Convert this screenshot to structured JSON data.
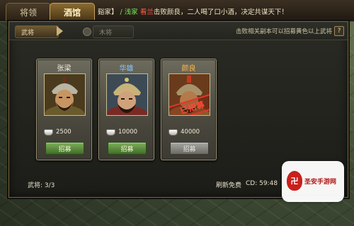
{
  "tabs": [
    {
      "label": "将领"
    },
    {
      "label": "酒馆"
    }
  ],
  "broadcast": {
    "prefix": "谿家】",
    "player": "/ 浅家",
    "general": "看兰",
    "text1": "击败",
    "target": "颜良",
    "text2": "，二人喝了口小酒，决定共谋天下！"
  },
  "panel": {
    "seg_active": "武将",
    "seg_inactive": "木将",
    "hint": "击败相关副本可以招募黄色以上武将",
    "help": "?"
  },
  "cards": [
    {
      "name": "张梁",
      "price": "2500",
      "button": "招募",
      "enabled": true,
      "stamp": ""
    },
    {
      "name": "华雄",
      "price": "10000",
      "button": "招募",
      "enabled": true,
      "stamp": ""
    },
    {
      "name": "颜良",
      "price": "40000",
      "button": "招募",
      "enabled": false,
      "stamp": "已招募"
    }
  ],
  "footer": {
    "count": "武将: 3/3",
    "refresh": "刷新免费",
    "cd": "CD: 59:48"
  },
  "watermark": {
    "logo": "卍",
    "text": "圣安手游网"
  },
  "colors": {
    "accent": "#c8a25a",
    "button_green": "#5f9240",
    "name_blue": "#8cc7ff",
    "name_orange": "#ffb84a"
  }
}
